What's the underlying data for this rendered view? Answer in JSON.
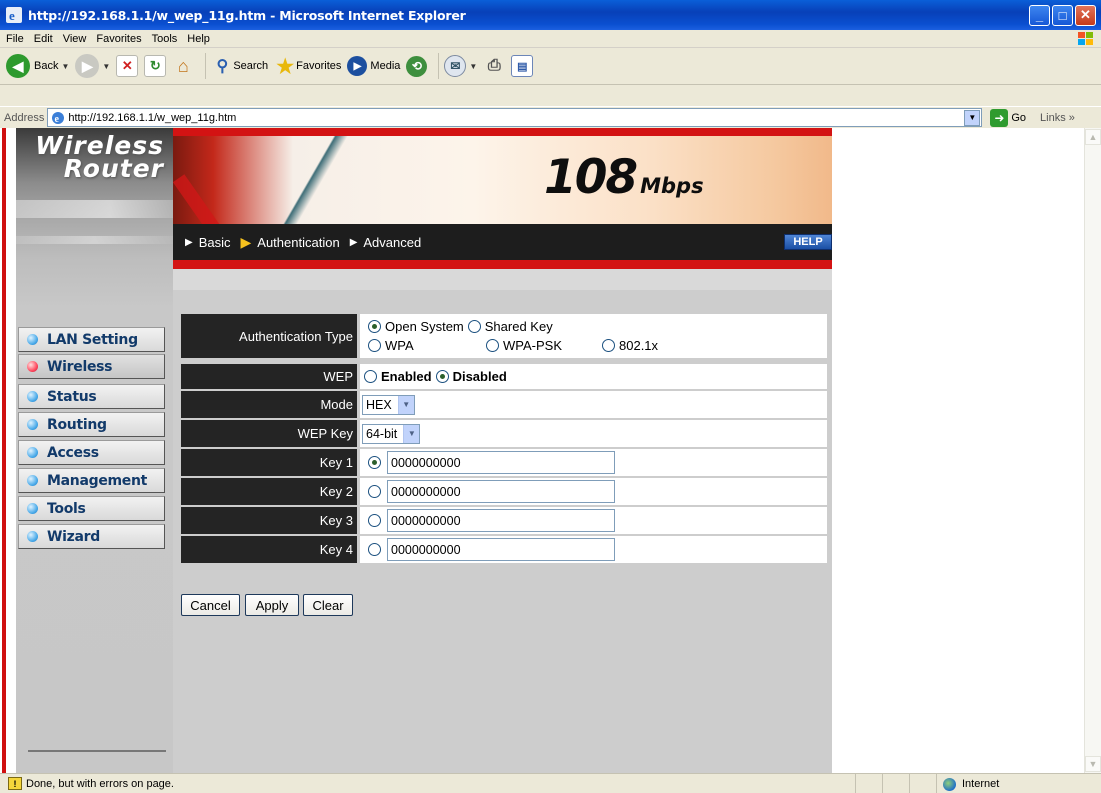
{
  "window": {
    "title": "http://192.168.1.1/w_wep_11g.htm - Microsoft Internet Explorer"
  },
  "menu": [
    "File",
    "Edit",
    "View",
    "Favorites",
    "Tools",
    "Help"
  ],
  "toolbar": {
    "back_label": "Back",
    "search_label": "Search",
    "favorites_label": "Favorites",
    "media_label": "Media"
  },
  "address": {
    "label": "Address",
    "url": "http://192.168.1.1/w_wep_11g.htm",
    "go_label": "Go",
    "links_label": "Links"
  },
  "brand": {
    "line1": "Wireless",
    "line2": "Router",
    "speed": "108",
    "speed_unit": "Mbps"
  },
  "top_nav": {
    "basic": "Basic",
    "authentication": "Authentication",
    "advanced": "Advanced",
    "help": "HELP"
  },
  "sidebar": {
    "items": [
      {
        "label": "LAN Setting"
      },
      {
        "label": "Wireless"
      },
      {
        "label": "Status"
      },
      {
        "label": "Routing"
      },
      {
        "label": "Access"
      },
      {
        "label": "Management"
      },
      {
        "label": "Tools"
      },
      {
        "label": "Wizard"
      }
    ],
    "active_index": 1
  },
  "form": {
    "auth_type_label": "Authentication Type",
    "auth_options": [
      "Open System",
      "Shared Key",
      "WPA",
      "WPA-PSK",
      "802.1x"
    ],
    "auth_selected": "Open System",
    "wep_label": "WEP",
    "wep_options": [
      "Enabled",
      "Disabled"
    ],
    "wep_selected": "Disabled",
    "mode_label": "Mode",
    "mode_value": "HEX",
    "wepkey_label": "WEP Key",
    "wepkey_value": "64-bit",
    "keys": [
      {
        "label": "Key 1",
        "value": "0000000000",
        "selected": true
      },
      {
        "label": "Key 2",
        "value": "0000000000",
        "selected": false
      },
      {
        "label": "Key 3",
        "value": "0000000000",
        "selected": false
      },
      {
        "label": "Key 4",
        "value": "0000000000",
        "selected": false
      }
    ]
  },
  "buttons": {
    "cancel": "Cancel",
    "apply": "Apply",
    "clear": "Clear"
  },
  "status": {
    "message": "Done, but with errors on page.",
    "zone": "Internet"
  },
  "colors": {
    "accent_red": "#d31313",
    "nav_text": "#123a6a"
  }
}
